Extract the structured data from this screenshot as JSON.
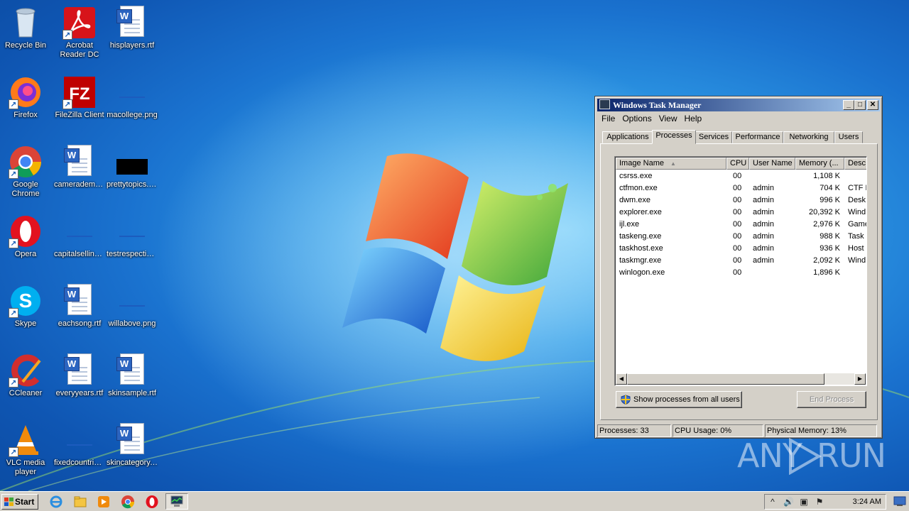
{
  "desktop": {
    "icons": [
      {
        "label": "Recycle Bin"
      },
      {
        "label": "Acrobat Reader DC"
      },
      {
        "label": "hisplayers.rtf"
      },
      {
        "label": "Firefox"
      },
      {
        "label": "FileZilla Client"
      },
      {
        "label": "macollege.png"
      },
      {
        "label": "Google Chrome"
      },
      {
        "label": "camerademocrats.rtf"
      },
      {
        "label": "prettytopics.png"
      },
      {
        "label": "Opera"
      },
      {
        "label": "capitalselling.png"
      },
      {
        "label": "testrespective.png"
      },
      {
        "label": "Skype"
      },
      {
        "label": "eachsong.rtf"
      },
      {
        "label": "willabove.png"
      },
      {
        "label": "CCleaner"
      },
      {
        "label": "everyyears.rtf"
      },
      {
        "label": "skinsample.rtf"
      },
      {
        "label": "VLC media player"
      },
      {
        "label": "fixedcountries.png"
      },
      {
        "label": "skincategory.rtf"
      }
    ],
    "icon_glyphs": {
      "word_doc": "W",
      "filezilla": "FZ",
      "skype": "S",
      "opera": "O",
      "shortcut_arrow": "↗"
    }
  },
  "taskmgr": {
    "title": "Windows Task Manager",
    "caption_buttons": {
      "minimize": "_",
      "maximize": "□",
      "close": "✕"
    },
    "menu": [
      "File",
      "Options",
      "View",
      "Help"
    ],
    "tabs": [
      "Applications",
      "Processes",
      "Services",
      "Performance",
      "Networking",
      "Users"
    ],
    "active_tab": "Processes",
    "columns": [
      "Image Name",
      "CPU",
      "User Name",
      "Memory (...",
      "Desc"
    ],
    "sort_indicator": "▲",
    "processes": [
      {
        "name": "csrss.exe",
        "cpu": "00",
        "user": "",
        "mem": "1,108 K",
        "desc": ""
      },
      {
        "name": "ctfmon.exe",
        "cpu": "00",
        "user": "admin",
        "mem": "704 K",
        "desc": "CTF L"
      },
      {
        "name": "dwm.exe",
        "cpu": "00",
        "user": "admin",
        "mem": "996 K",
        "desc": "Desk"
      },
      {
        "name": "explorer.exe",
        "cpu": "00",
        "user": "admin",
        "mem": "20,392 K",
        "desc": "Wind"
      },
      {
        "name": "ijl.exe",
        "cpu": "00",
        "user": "admin",
        "mem": "2,976 K",
        "desc": "Game"
      },
      {
        "name": "taskeng.exe",
        "cpu": "00",
        "user": "admin",
        "mem": "988 K",
        "desc": "Task"
      },
      {
        "name": "taskhost.exe",
        "cpu": "00",
        "user": "admin",
        "mem": "936 K",
        "desc": "Host"
      },
      {
        "name": "taskmgr.exe",
        "cpu": "00",
        "user": "admin",
        "mem": "2,092 K",
        "desc": "Wind"
      },
      {
        "name": "winlogon.exe",
        "cpu": "00",
        "user": "",
        "mem": "1,896 K",
        "desc": ""
      }
    ],
    "show_all_button": "Show processes from all users",
    "end_process_button": "End Process",
    "status": {
      "processes": "Processes: 33",
      "cpu": "CPU Usage: 0%",
      "memory": "Physical Memory: 13%"
    }
  },
  "taskbar": {
    "start_label": "Start",
    "clock": "3:24 AM",
    "pinned": [
      "internet-explorer-icon",
      "explorer-folder-icon",
      "media-player-icon",
      "chrome-icon",
      "opera-icon",
      "task-manager-icon"
    ]
  },
  "watermark": {
    "left": "ANY",
    "right": "RUN"
  },
  "colors": {
    "desktop_blue": "#1a72cf",
    "title_active": "#0a246a",
    "classic_face": "#d4d0c8"
  }
}
